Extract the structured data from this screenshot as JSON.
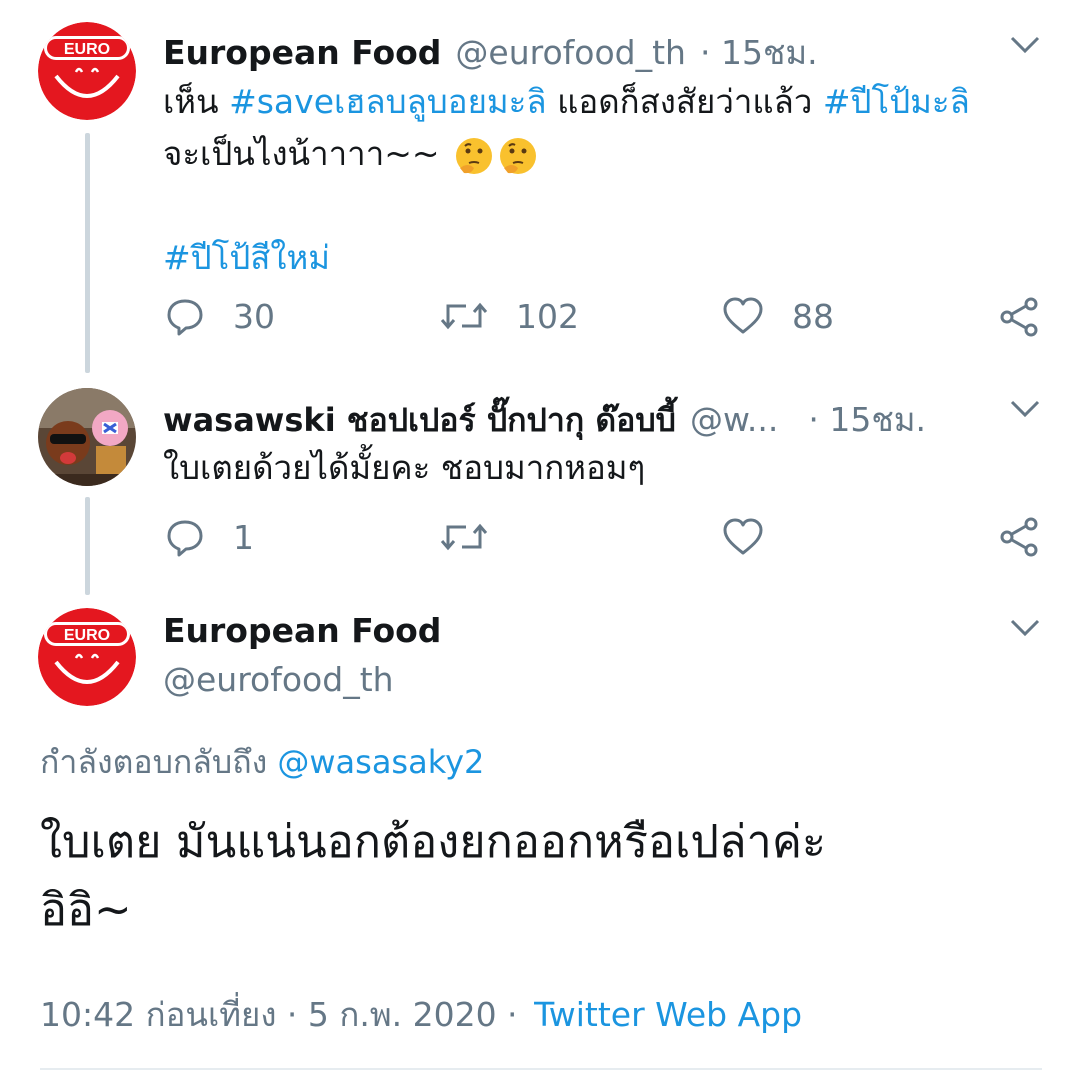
{
  "tweet1": {
    "name": "European Food",
    "handle": "@eurofood_th",
    "time": "· 15ชม.",
    "text_pre": "เห็น ",
    "hashtag1": "#saveเฮลบลูบอยมะลิ",
    "text_mid": " แอดก็สงสัยว่าแล้ว ",
    "hashtag2": "#ปีโป้มะลิ",
    "line2": "จะเป็นไงน้าาาา~~",
    "hashtag3": "#ปีโป้สีใหม่",
    "replies": "30",
    "retweets": "102",
    "likes": "88"
  },
  "tweet2": {
    "name": "wasawski ชอปเปอร์ ปั๊กปากุ ด๊อบบี้",
    "handle": "@w...",
    "time": "· 15ชม.",
    "text": "ใบเตยด้วยได้มั้ยคะ ชอบมากหอมๆ",
    "replies": "1"
  },
  "tweet3": {
    "name": "European Food",
    "handle": "@eurofood_th",
    "reply_label": "กำลังตอบกลับถึง ",
    "reply_to": "@wasasaky2",
    "text_line1": "ใบเตย มันแน่นอกต้องยกออกหรือเปล่าค่ะ",
    "text_line2": "อิอิ~",
    "timestamp": "10:42 ก่อนเที่ยง · 5 ก.พ. 2020 ·",
    "source": "Twitter Web App"
  },
  "avatar_logo_text": "EURO",
  "colors": {
    "accent": "#1b95e0",
    "brand_red": "#e4171f",
    "muted": "#657786"
  }
}
